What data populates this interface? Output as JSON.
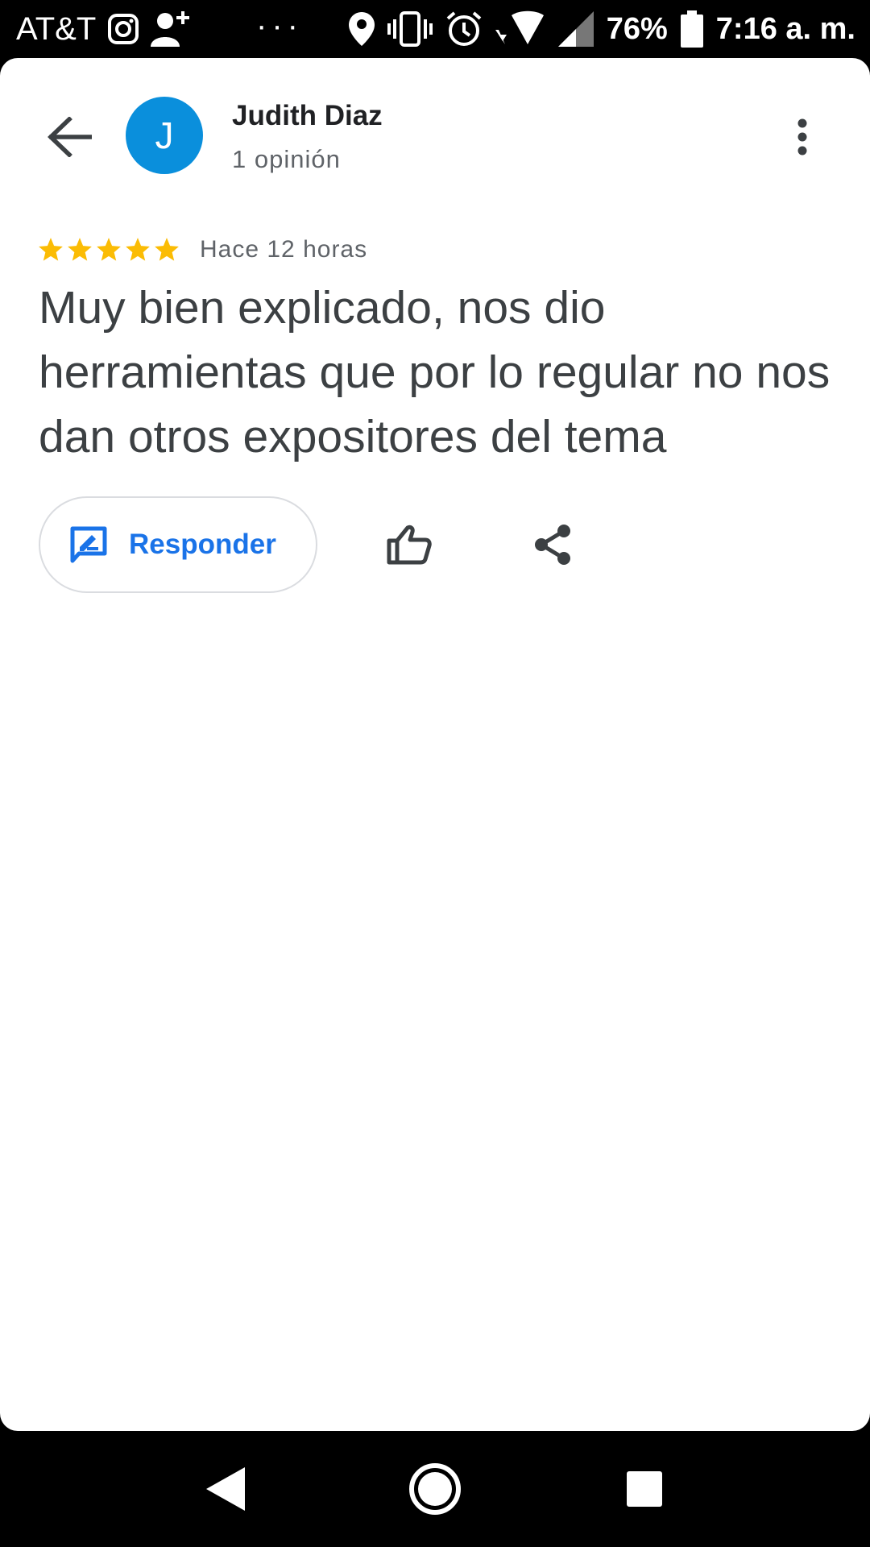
{
  "status_bar": {
    "carrier": "AT&T",
    "dots": "···",
    "battery_percent": "76%",
    "time": "7:16 a. m.",
    "icons": [
      "instagram-icon",
      "add-person-icon",
      "location-icon",
      "vibrate-icon",
      "alarm-icon",
      "wifi-icon",
      "signal-icon",
      "battery-icon"
    ]
  },
  "header": {
    "avatar_initial": "J",
    "avatar_color": "#0a8fdc",
    "name": "Judith Diaz",
    "review_count": "1 opinión"
  },
  "review": {
    "rating": 5,
    "max_rating": 5,
    "star_color": "#fbbc04",
    "time_ago": "Hace 12 horas",
    "text": "Muy bien explicado, nos dio herramientas que por lo regular no nos dan otros expositores del tema"
  },
  "actions": {
    "reply_label": "Responder",
    "accent_color": "#1a73e8"
  },
  "nav": {
    "buttons": [
      "back-triangle-icon",
      "home-circle-icon",
      "recents-square-icon"
    ]
  }
}
